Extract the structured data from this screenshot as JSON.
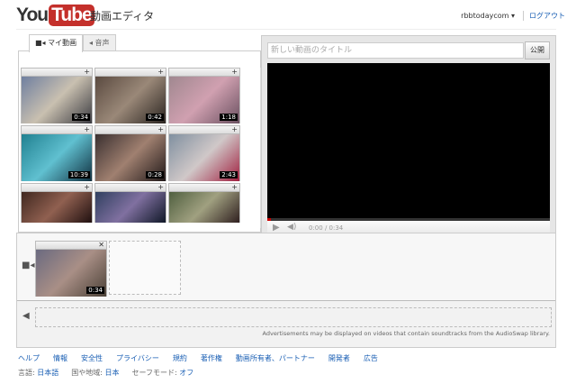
{
  "header": {
    "logo_you": "You",
    "logo_tube": "Tube",
    "title": "動画エディタ",
    "user": "rbbtodaycom ▾",
    "logout": "ログアウト"
  },
  "tabs": [
    {
      "label": "■◂ マイ動画"
    },
    {
      "label": "◂ 音声"
    }
  ],
  "library": {
    "videos": [
      {
        "duration": "0:34"
      },
      {
        "duration": "0:42"
      },
      {
        "duration": "1:18"
      },
      {
        "duration": "10:39"
      },
      {
        "duration": "0:28"
      },
      {
        "duration": "2:43"
      },
      {
        "duration": ""
      },
      {
        "duration": ""
      },
      {
        "duration": ""
      }
    ],
    "add_label": "+"
  },
  "player": {
    "title_placeholder": "新しい動画のタイトル",
    "publish": "公開",
    "time": "0:00 / 0:34"
  },
  "timeline": {
    "clip_duration": "0:34",
    "ads_note": "Advertisements may be displayed on videos that contain soundtracks from the AudioSwap library."
  },
  "footer": {
    "links": [
      "ヘルプ",
      "情報",
      "安全性",
      "プライバシー",
      "規約",
      "著作権",
      "動画所有者、パートナー",
      "開発者",
      "広告"
    ],
    "language_label": "言語:",
    "language": "日本語",
    "region_label": "国や地域:",
    "region": "日本",
    "safe_label": "セーフモード:",
    "safe": "オフ"
  }
}
